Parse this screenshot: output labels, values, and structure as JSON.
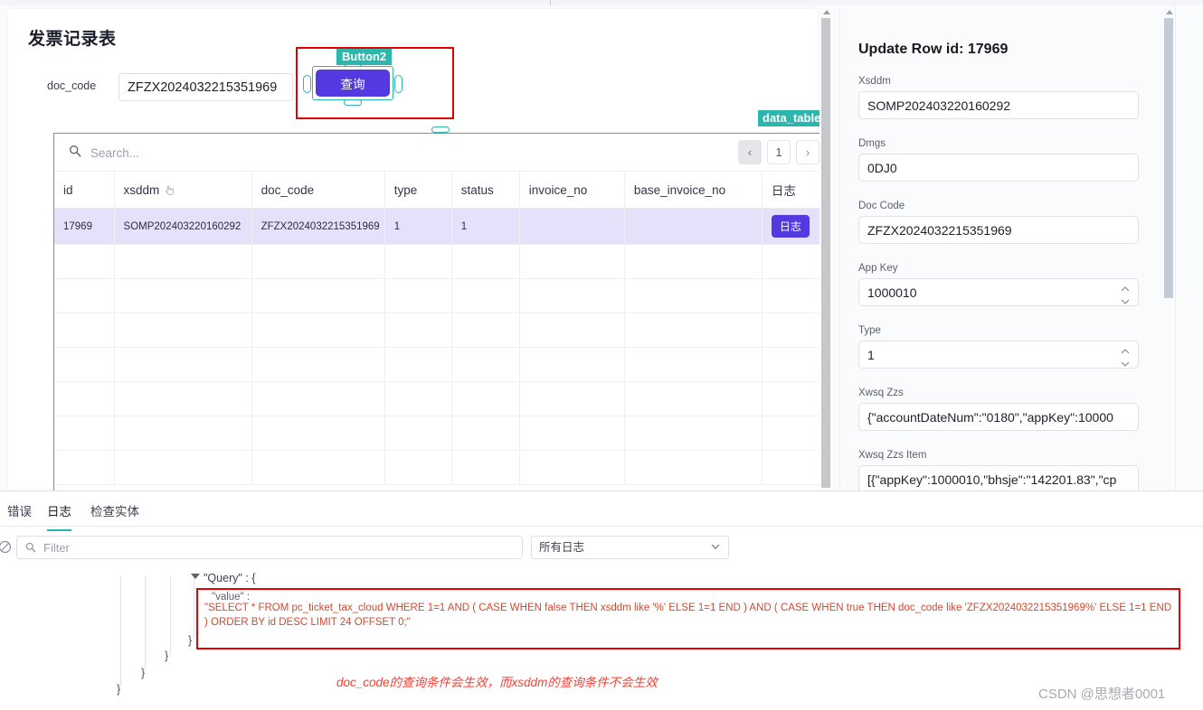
{
  "app": {
    "page_title": "发票记录表",
    "doc_code_label": "doc_code",
    "doc_code_value": "ZFZX2024032215351969",
    "query_button_label": "查询",
    "button_tag": "Button2",
    "data_table_tag": "data_table"
  },
  "table": {
    "search_placeholder": "Search...",
    "pager": {
      "prev": "‹",
      "page": "1",
      "next": "›"
    },
    "columns": [
      "id",
      "xsddm",
      "doc_code",
      "type",
      "status",
      "invoice_no",
      "base_invoice_no",
      "日志"
    ],
    "rows": [
      {
        "id": "17969",
        "xsddm": "SOMP202403220160292",
        "doc_code": "ZFZX2024032215351969",
        "type": "1",
        "status": "1",
        "invoice_no": "",
        "base_invoice_no": "",
        "log_label": "日志"
      }
    ],
    "empty_row_count": 7
  },
  "right_panel": {
    "title": "Update Row id: 17969",
    "fields": [
      {
        "label": "Xsddm",
        "value": "SOMP202403220160292",
        "type": "text"
      },
      {
        "label": "Dmgs",
        "value": "0DJ0",
        "type": "text"
      },
      {
        "label": "Doc Code",
        "value": "ZFZX2024032215351969",
        "type": "text"
      },
      {
        "label": "App Key",
        "value": "1000010",
        "type": "number"
      },
      {
        "label": "Type",
        "value": "1",
        "type": "number"
      },
      {
        "label": "Xwsq Zzs",
        "value": "{\"accountDateNum\":\"0180\",\"appKey\":10000",
        "type": "text"
      },
      {
        "label": "Xwsq Zzs Item",
        "value": "[{\"appKey\":1000010,\"bhsje\":\"142201.83\",\"cp",
        "type": "text"
      }
    ]
  },
  "devtools": {
    "tabs": [
      {
        "label": "错误",
        "active": false
      },
      {
        "label": "日志",
        "active": true
      },
      {
        "label": "检查实体",
        "active": false
      }
    ],
    "filter_placeholder": "Filter",
    "level_selected": "所有日志",
    "level_options": [
      "所有日志"
    ],
    "log": {
      "query_key": "\"Query\" : {",
      "value_key": "\"value\" :",
      "sql": "\"SELECT * FROM pc_ticket_tax_cloud WHERE 1=1 AND ( CASE WHEN false THEN xsddm like '%' ELSE 1=1 END ) AND ( CASE WHEN true THEN doc_code like 'ZFZX2024032215351969%' ELSE 1=1 END ) ORDER BY id DESC LIMIT 24 OFFSET 0;\"",
      "braces": [
        "}",
        "}",
        "}",
        "}"
      ]
    }
  },
  "annotations": {
    "red_note": "doc_code的查询条件会生效，而xsddm的查询条件不会生效",
    "watermark": "CSDN @思想者0001"
  },
  "colors": {
    "accent_teal": "#2bb6ae",
    "primary_purple": "#5239e0",
    "annotation_red": "#e60000",
    "sql_red": "#d5482e",
    "note_red": "#ff3b30",
    "row_selected": "#e6e1fb"
  }
}
